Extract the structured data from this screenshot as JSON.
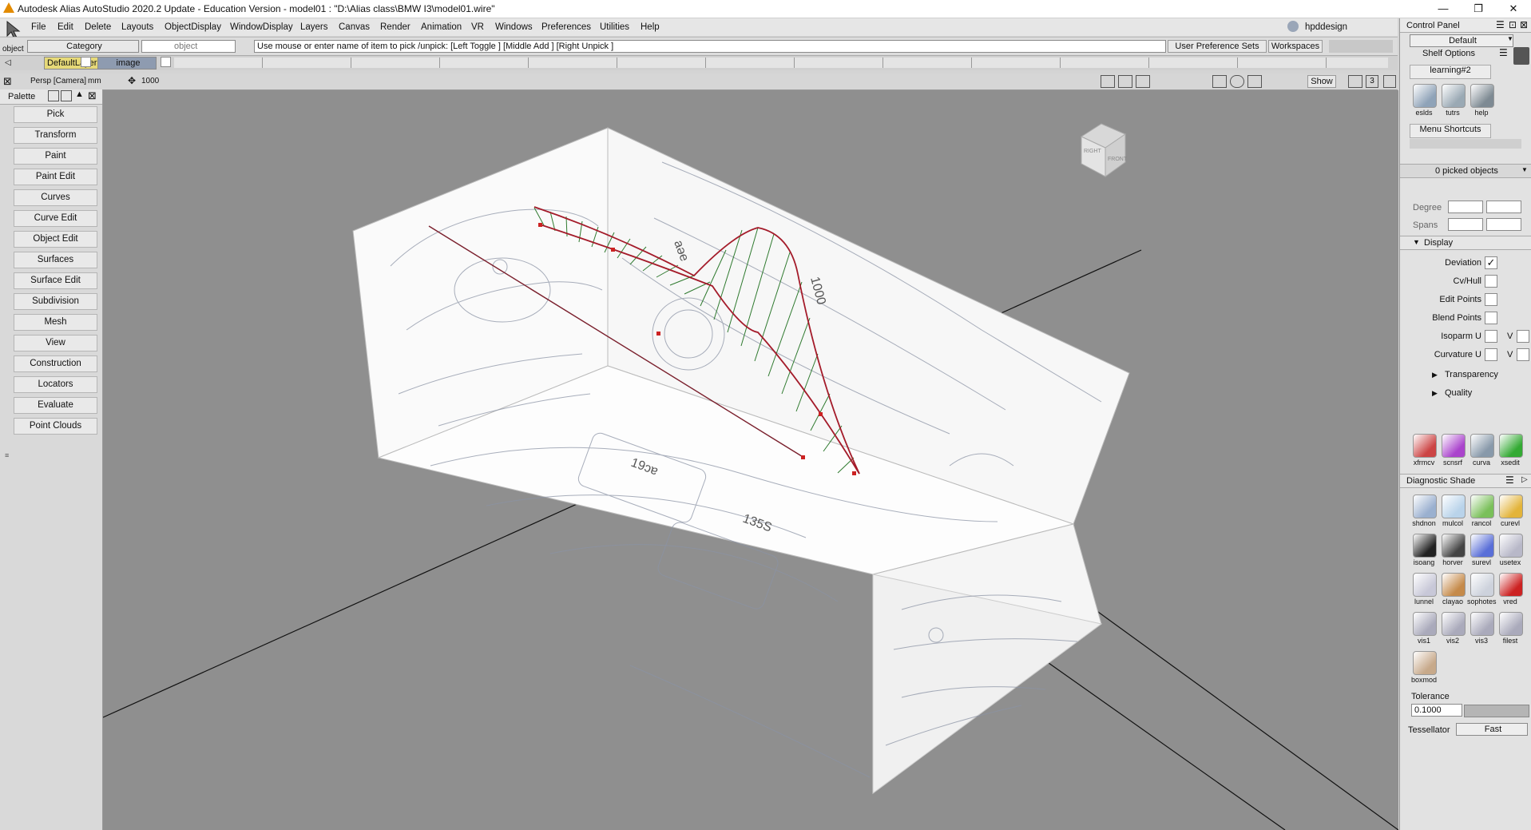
{
  "window": {
    "title": "Autodesk Alias AutoStudio 2020.2 Update - Education Version   - model01 : \"D:\\Alias class\\BMW I3\\model01.wire\"",
    "controls": [
      "—",
      "❐",
      "✕"
    ]
  },
  "menu": [
    "File",
    "Edit",
    "Delete",
    "Layouts",
    "ObjectDisplay",
    "WindowDisplay",
    "Layers",
    "Canvas",
    "Render",
    "Animation",
    "VR",
    "Windows",
    "Preferences",
    "Utilities",
    "Help"
  ],
  "user": {
    "name": "hpddesign"
  },
  "toolbar": {
    "object_label": "object",
    "category_label": "Category",
    "object_field": "object",
    "prompt": "Use mouse or enter name of item to pick /unpick: [Left Toggle ] [Middle Add ] [Right Unpick ]",
    "user_pref_sets": "User Preference Sets",
    "workspaces": "Workspaces"
  },
  "layers": {
    "default_layer": "DefaultLayer",
    "image_layer": "image"
  },
  "viewport_header": {
    "camera": "Persp [Camera]",
    "units": "mm",
    "scale": "1000",
    "show_button": "Show",
    "num": "3"
  },
  "palette": {
    "title": "Palette",
    "items": [
      "Pick",
      "Transform",
      "Paint",
      "Paint Edit",
      "Curves",
      "Curve Edit",
      "Object Edit",
      "Surfaces",
      "Surface Edit",
      "Subdivision",
      "Mesh",
      "View",
      "Construction",
      "Locators",
      "Evaluate",
      "Point Clouds"
    ]
  },
  "viewcube": {
    "right": "RIGHT",
    "front": "FRONT"
  },
  "canvas_labels": {
    "side_a": "aəe",
    "side_b": "1000",
    "floor_a": "19ɔɐ",
    "floor_b": "135S"
  },
  "control_panel": {
    "title": "Control Panel",
    "preset": "Default",
    "shelf_options": "Shelf Options",
    "shelf_tab": "learning#2",
    "shelf_icons": [
      {
        "label": "eslds",
        "color": "#8fa3b8"
      },
      {
        "label": "tutrs",
        "color": "#9aa9b4"
      },
      {
        "label": "help",
        "color": "#7e8a93"
      }
    ],
    "menu_shortcuts": "Menu Shortcuts",
    "picked": "0 picked objects",
    "degree_label": "Degree",
    "spans_label": "Spans",
    "display_section": "Display",
    "options": [
      {
        "label": "Deviation",
        "checked": true
      },
      {
        "label": "Cv/Hull",
        "checked": false
      },
      {
        "label": "Edit Points",
        "checked": false
      },
      {
        "label": "Blend Points",
        "checked": false
      },
      {
        "label": "Isoparm U",
        "checked": false,
        "v": "V"
      },
      {
        "label": "Curvature U",
        "checked": false,
        "v": "V"
      }
    ],
    "transparency": "Transparency",
    "quality": "Quality",
    "tool_icons": [
      {
        "label": "xfrmcv",
        "color": "#c44"
      },
      {
        "label": "scnsrf",
        "color": "#a4c"
      },
      {
        "label": "curva",
        "color": "#89a"
      },
      {
        "label": "xsedit",
        "color": "#3a3"
      }
    ]
  },
  "diagnostic_shade": {
    "title": "Diagnostic Shade",
    "icons": [
      {
        "label": "shdnon",
        "color": "#9ab0cf"
      },
      {
        "label": "mulcol",
        "color": "#b9d3ea"
      },
      {
        "label": "rancol",
        "color": "#7ac05a"
      },
      {
        "label": "curevl",
        "color": "#e3b43a"
      },
      {
        "label": "isoang",
        "color": "#222"
      },
      {
        "label": "horver",
        "color": "#444"
      },
      {
        "label": "surevl",
        "color": "#5a6fd8"
      },
      {
        "label": "usetex",
        "color": "#b8b8c8"
      },
      {
        "label": "lunnel",
        "color": "#c8c8d8"
      },
      {
        "label": "clayao",
        "color": "#c58a4a"
      },
      {
        "label": "sophotes",
        "color": "#cdd2dc"
      },
      {
        "label": "vred",
        "color": "#c22"
      },
      {
        "label": "vis1",
        "color": "#aab"
      },
      {
        "label": "vis2",
        "color": "#aab"
      },
      {
        "label": "vis3",
        "color": "#aab"
      },
      {
        "label": "filest",
        "color": "#aab"
      },
      {
        "label": "boxmod",
        "color": "#c7a98a"
      }
    ],
    "tolerance_label": "Tolerance",
    "tolerance_value": "0.1000",
    "tessellator_label": "Tessellator",
    "tessellator_value": "Fast"
  }
}
